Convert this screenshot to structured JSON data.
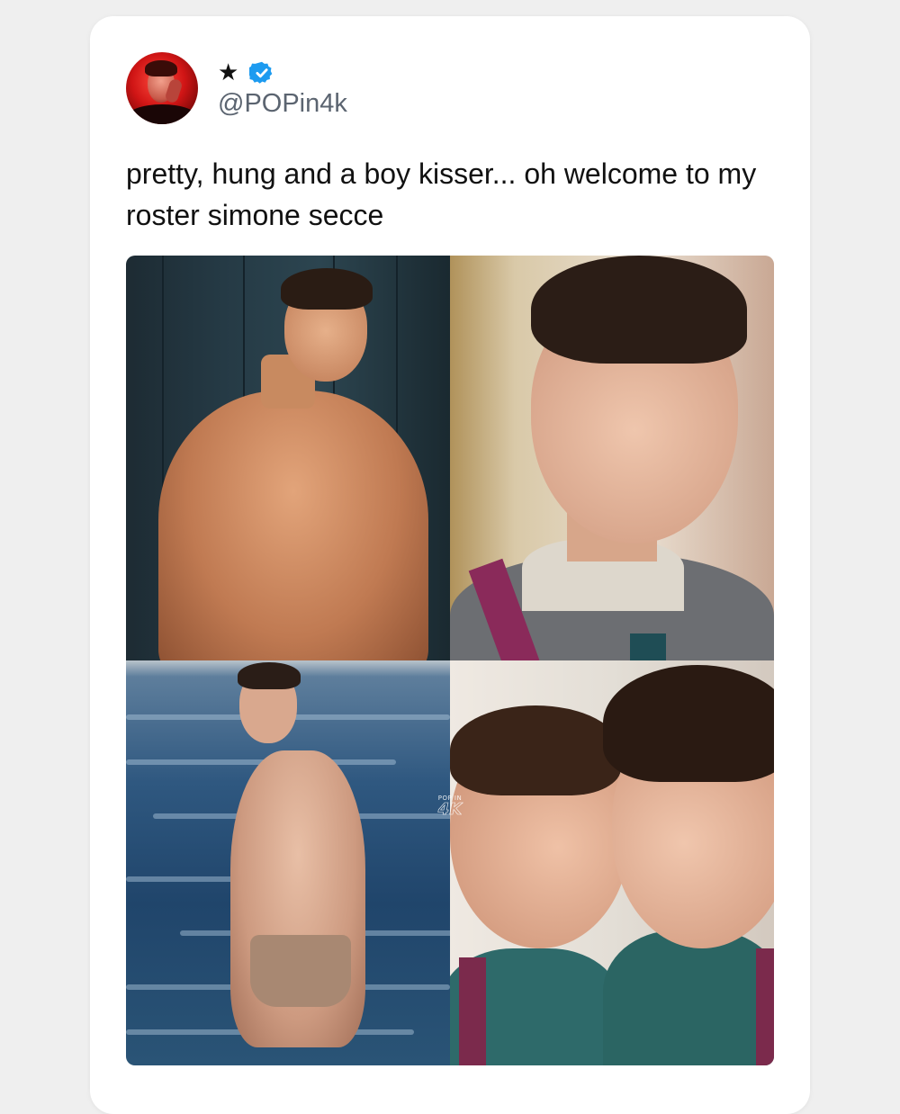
{
  "post": {
    "display_name_icon": "★",
    "verified_badge": "verified-badge-icon",
    "handle": "@POPin4k",
    "text": "pretty, hung and a boy kisser... oh welcome to my roster simone secce"
  },
  "media": {
    "photos": [
      "photo-shirtless-locker-room",
      "photo-portrait-uniform",
      "photo-sea-shirtless",
      "photo-kiss"
    ],
    "watermark": {
      "top": "POP IN",
      "bottom": "4K"
    }
  },
  "colors": {
    "background": "#efefef",
    "card": "#ffffff",
    "verified": "#1d9bf0",
    "handle": "#5b6470",
    "text": "#111111"
  }
}
